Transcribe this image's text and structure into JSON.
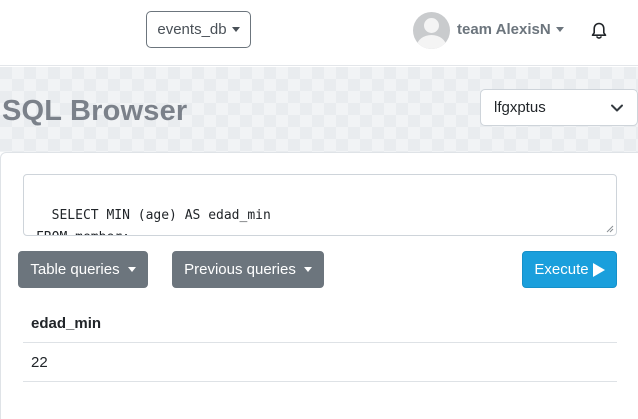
{
  "topbar": {
    "database": {
      "label": "events_db",
      "icon": "chevron-down-icon"
    },
    "user": {
      "name": "team AlexisN",
      "avatar_icon": "user-avatar-icon",
      "dropdown_icon": "chevron-down-icon"
    },
    "notifications_icon": "bell-icon"
  },
  "header": {
    "title": "SQL Browser",
    "schema_select": {
      "value": "lfgxptus",
      "icon": "chevron-down-icon"
    }
  },
  "editor": {
    "query": "SELECT MIN (age) AS edad_min\nFROM member;"
  },
  "toolbar": {
    "table_queries_label": "Table queries",
    "previous_queries_label": "Previous queries",
    "execute_label": "Execute",
    "execute_icon": "play-icon"
  },
  "results": {
    "columns": [
      "edad_min"
    ],
    "rows": [
      [
        "22"
      ]
    ]
  },
  "colors": {
    "accent": "#1a9fdc",
    "secondary_button": "#6c757d",
    "title": "#7b818a",
    "header_band": "#e9ecef"
  }
}
